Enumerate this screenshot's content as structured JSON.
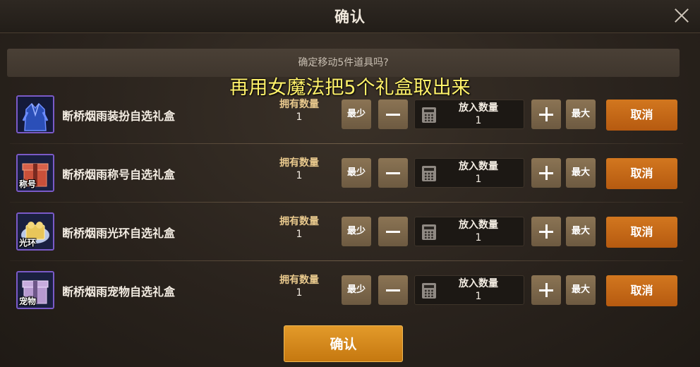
{
  "dialog": {
    "title": "确认",
    "prompt": "确定移动5件道具吗?",
    "overlay_caption": "再用女魔法把5个礼盒取出来",
    "confirm_label": "确认"
  },
  "columns": {
    "owned_label": "拥有数量",
    "put_label": "放入数量",
    "min_label": "最少",
    "max_label": "最大",
    "cancel_label": "取消"
  },
  "items": [
    {
      "name": "断桥烟雨装扮自选礼盒",
      "owned": "1",
      "put": "1",
      "tag": "",
      "icon": "costume-outfit-icon",
      "color": "#2b4fb8"
    },
    {
      "name": "断桥烟雨称号自选礼盒",
      "owned": "1",
      "put": "1",
      "tag": "称号",
      "icon": "title-giftbox-icon",
      "color": "#c9503a"
    },
    {
      "name": "断桥烟雨光环自选礼盒",
      "owned": "1",
      "put": "1",
      "tag": "光环",
      "icon": "aura-giftbox-icon",
      "color": "#e8c65a"
    },
    {
      "name": "断桥烟雨宠物自选礼盒",
      "owned": "1",
      "put": "1",
      "tag": "宠物",
      "icon": "pet-giftbox-icon",
      "color": "#b79ad0"
    }
  ],
  "colors": {
    "cancel_button": "#c4671a",
    "confirm_button": "#d48a1d",
    "label_gold": "#e9c98d",
    "caption_yellow": "#fff26a"
  }
}
